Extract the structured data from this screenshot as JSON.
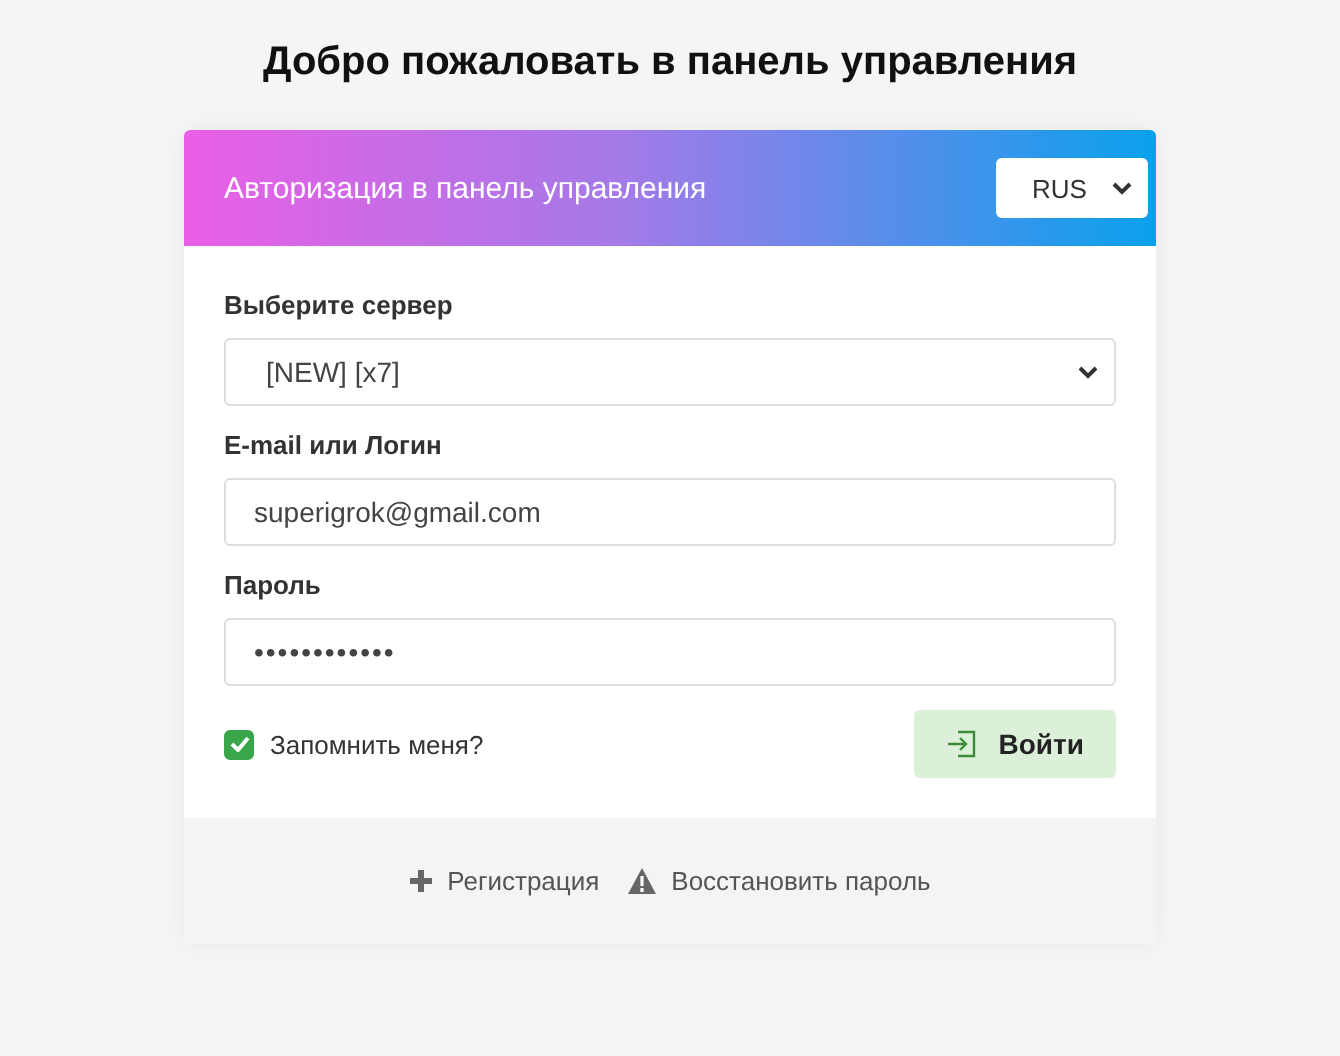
{
  "title": "Добро пожаловать в панель управления",
  "card": {
    "header": "Авторизация в панель управления",
    "language": "RUS",
    "server": {
      "label": "Выберите сервер",
      "value": "[NEW] [x7]"
    },
    "login": {
      "label": "E-mail или Логин",
      "value": "superigrok@gmail.com"
    },
    "password": {
      "label": "Пароль",
      "value": "••••••••••••"
    },
    "remember": {
      "label": "Запомнить меня?",
      "checked": true
    },
    "submit": "Войти"
  },
  "footer_links": [
    "Регистрация",
    "Восстановить пароль"
  ]
}
